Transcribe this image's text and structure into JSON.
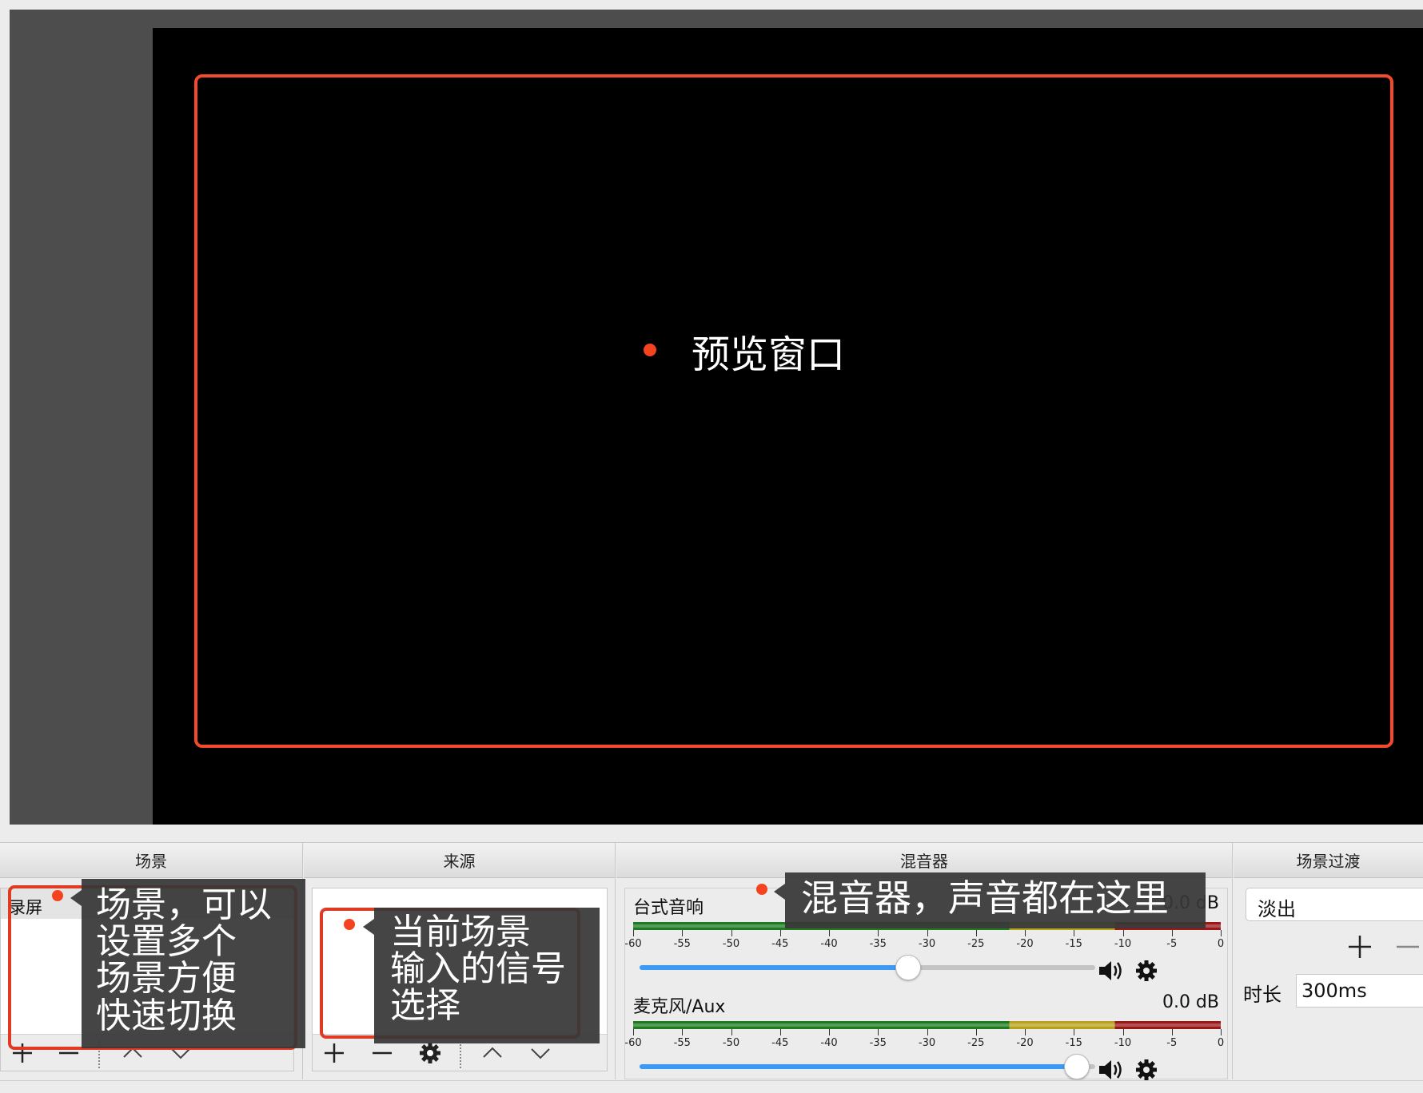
{
  "preview": {
    "label": "预览窗口"
  },
  "panels": {
    "scenes": {
      "title": "场景",
      "items": [
        "录屏"
      ]
    },
    "sources": {
      "title": "来源"
    },
    "mixer": {
      "title": "混音器",
      "channels": [
        {
          "name": "台式音响",
          "db": "0.0 dB",
          "level": 0.59
        },
        {
          "name": "麦克风/Aux",
          "db": "0.0 dB",
          "level": 0.96
        }
      ],
      "tick_labels": [
        "-60",
        "-55",
        "-50",
        "-45",
        "-40",
        "-35",
        "-30",
        "-25",
        "-20",
        "-15",
        "-10",
        "-5",
        "0"
      ]
    },
    "transitions": {
      "title": "场景过渡",
      "selected": "淡出",
      "duration_label": "时长",
      "duration_value": "300ms"
    }
  },
  "annotations": {
    "scenes": [
      "场景，可以",
      "设置多个",
      "场景方便",
      "快速切换"
    ],
    "sources": [
      "当前场景",
      "输入的信号",
      "选择"
    ],
    "mixer": "混音器，声音都在这里"
  },
  "colors": {
    "highlight": "#f24a2a",
    "dot": "#f4431f",
    "slider": "#3b9af5",
    "callout_bg": "#373737"
  },
  "icons": [
    "plus-icon",
    "minus-icon",
    "gear-icon",
    "chevron-up-icon",
    "chevron-down-icon",
    "speaker-icon"
  ]
}
